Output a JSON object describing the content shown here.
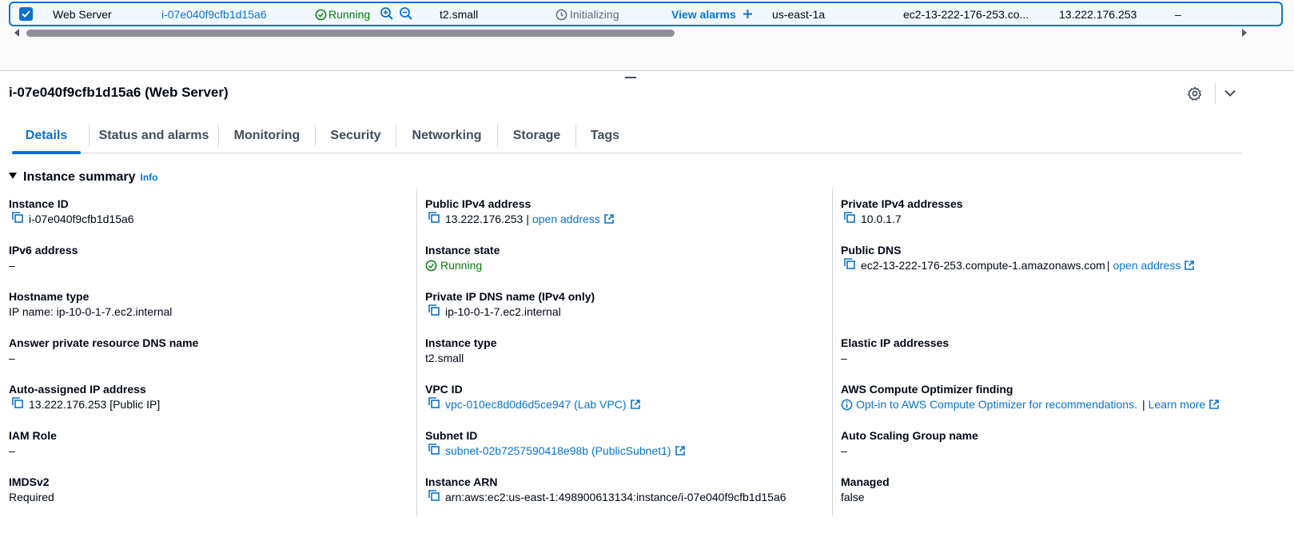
{
  "instance_row": {
    "name": "Web Server",
    "instance_id": "i-07e040f9cfb1d15a6",
    "state": "Running",
    "type": "t2.small",
    "status_check": "Initializing",
    "alarms_link": "View alarms",
    "az": "us-east-1a",
    "public_dns": "ec2-13-222-176-253.co...",
    "public_ip": "13.222.176.253",
    "dash": "–"
  },
  "panel": {
    "title": "i-07e040f9cfb1d15a6 (Web Server)"
  },
  "tabs": [
    {
      "label": "Details"
    },
    {
      "label": "Status and alarms"
    },
    {
      "label": "Monitoring"
    },
    {
      "label": "Security"
    },
    {
      "label": "Networking"
    },
    {
      "label": "Storage"
    },
    {
      "label": "Tags"
    }
  ],
  "summary": {
    "title": "Instance summary",
    "info": "Info",
    "col1": [
      {
        "label": "Instance ID",
        "value": "i-07e040f9cfb1d15a6"
      },
      {
        "label": "IPv6 address",
        "value": "–"
      },
      {
        "label": "Hostname type",
        "value": "IP name: ip-10-0-1-7.ec2.internal"
      },
      {
        "label": "Answer private resource DNS name",
        "value": "–"
      },
      {
        "label": "Auto-assigned IP address",
        "value": "13.222.176.253 [Public IP]"
      },
      {
        "label": "IAM Role",
        "value": "–"
      },
      {
        "label": "IMDSv2",
        "value": "Required"
      }
    ],
    "col2": [
      {
        "label": "Public IPv4 address",
        "value": "13.222.176.253",
        "sep": "|",
        "link": "open address"
      },
      {
        "label": "Instance state",
        "value": "Running"
      },
      {
        "label": "Private IP DNS name (IPv4 only)",
        "value": "ip-10-0-1-7.ec2.internal"
      },
      {
        "label": "Instance type",
        "value": "t2.small"
      },
      {
        "label": "VPC ID",
        "value": "vpc-010ec8d0d6d5ce947 (Lab VPC)"
      },
      {
        "label": "Subnet ID",
        "value": "subnet-02b7257590418e98b (PublicSubnet1)"
      },
      {
        "label": "Instance ARN",
        "value": "arn:aws:ec2:us-east-1:498900613134:instance/i-07e040f9cfb1d15a6"
      }
    ],
    "col3": [
      {
        "label": "Private IPv4 addresses",
        "value": "10.0.1.7"
      },
      {
        "label": "Public DNS",
        "value": "ec2-13-222-176-253.compute-1.amazonaws.com",
        "sep": "|",
        "link": "open address"
      },
      {
        "label": "Elastic IP addresses",
        "value": "–"
      },
      {
        "label": "AWS Compute Optimizer finding",
        "value": "Opt-in to AWS Compute Optimizer for recommendations.",
        "sep": "|",
        "link": "Learn more"
      },
      {
        "label": "Auto Scaling Group name",
        "value": "–"
      },
      {
        "label": "Managed",
        "value": "false"
      }
    ]
  }
}
